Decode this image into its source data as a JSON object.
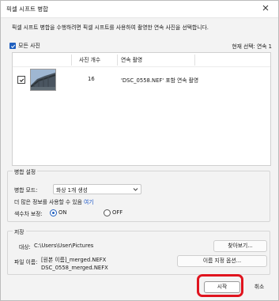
{
  "window": {
    "title": "픽셀 시프트 병합"
  },
  "instruction": "픽셀 시프트 병합을 수행하려면 픽셀 시프트를 사용하여 촬영한 연속 사진을 선택합니다.",
  "select_all": {
    "label": "모든 사진",
    "checked": true
  },
  "selection_status": "현재 선택: 연속 1",
  "list": {
    "columns": [
      "사진 개수",
      "연속 촬영"
    ],
    "rows": [
      {
        "checked": true,
        "count": "16",
        "description": "'DSC_0558.NEF' 포함 연속 촬영"
      }
    ]
  },
  "merge_settings": {
    "group_label": "병합 설정",
    "mode_label": "병합 모드:",
    "mode_value": "화상 1개 생성",
    "info_text": "더 많은 정보를 사용할 수 있음",
    "info_link": "여기",
    "color_correction_label": "색수차 보정:",
    "options": [
      {
        "label": "ON",
        "selected": true
      },
      {
        "label": "OFF",
        "selected": false
      }
    ]
  },
  "save": {
    "group_label": "저장",
    "destination_label": "대상:",
    "destination_path": "C:\\Users\\User\\Pictures",
    "browse_button": "찾아보기...",
    "filename_label": "파일 이름:",
    "filename_pattern": "[원본 이름]_merged.NEFX",
    "filename_example": "DSC_0558_merged.NEFX",
    "naming_options_button": "이름 지정 옵션..."
  },
  "actions": {
    "start": "시작",
    "cancel": "취소"
  },
  "colors": {
    "accent": "#1f5fbf",
    "highlight": "#e0141e",
    "link": "#1a56c8"
  }
}
